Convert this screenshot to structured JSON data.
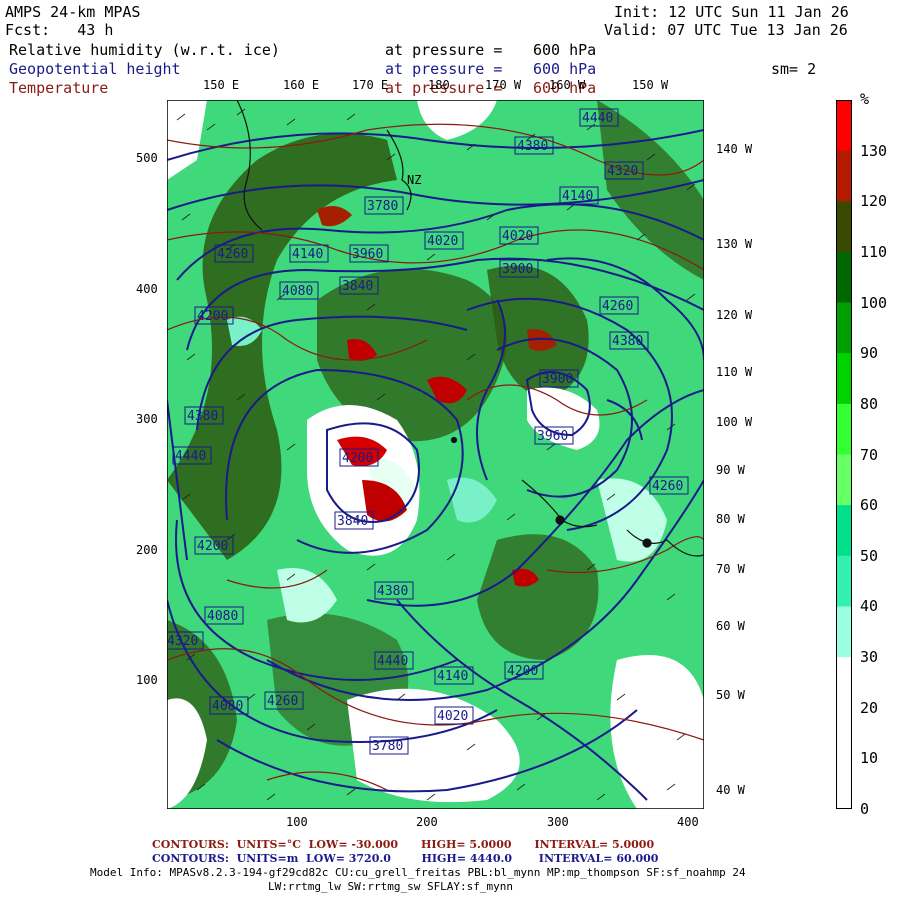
{
  "header": {
    "model": "AMPS 24-km MPAS",
    "fcst_label": "Fcst:",
    "fcst_value": "43 h",
    "init": "Init: 12 UTC Sun 11 Jan 26",
    "valid": "Valid: 07 UTC Tue 13 Jan 26",
    "fields": [
      {
        "name": "Relative humidity (w.r.t. ice)",
        "level_label": "at pressure =",
        "level": "600 hPa",
        "color": "#000000"
      },
      {
        "name": "Geopotential height",
        "level_label": "at pressure =",
        "level": "600 hPa",
        "color": "#1a1a8c"
      },
      {
        "name": "Temperature",
        "level_label": "at pressure =",
        "level": "600 hPa",
        "color": "#8b1a10"
      }
    ],
    "smoothing": "sm= 2"
  },
  "map": {
    "top_lon_labels": [
      "150 E",
      "160 E",
      "170 E",
      "180",
      "170 W",
      "160 W",
      "150 W"
    ],
    "right_lon_labels": [
      "140 W",
      "130 W",
      "120 W",
      "110 W",
      "100 W",
      "90 W",
      "80 W",
      "70 W",
      "60 W",
      "50 W",
      "40 W"
    ],
    "x_ticks": [
      "100",
      "200",
      "300",
      "400"
    ],
    "y_ticks": [
      "500",
      "400",
      "300",
      "200",
      "100"
    ],
    "height_labels": [
      "4380",
      "4440",
      "4260",
      "4200",
      "4140",
      "4080",
      "4020",
      "3960",
      "3900",
      "3840",
      "3780",
      "4260",
      "4380",
      "4440",
      "4200",
      "4080",
      "3960",
      "3900",
      "4020",
      "4140",
      "4320",
      "4380",
      "4260",
      "4200",
      "3840",
      "3780",
      "4080",
      "4020",
      "4140",
      "4200",
      "4260",
      "4320",
      "4380",
      "4440"
    ],
    "station_label": "NZ"
  },
  "colorbar": {
    "unit": "%",
    "labels": [
      "130",
      "120",
      "110",
      "100",
      "90",
      "80",
      "70",
      "60",
      "50",
      "40",
      "30",
      "20",
      "10",
      "0"
    ],
    "colors": [
      "#ff0000",
      "#b31a00",
      "#3a4a00",
      "#006600",
      "#00a000",
      "#00d200",
      "#33ff33",
      "#66ff66",
      "#00e08a",
      "#33f0b0",
      "#99ffe0",
      "#ffffff",
      "#ffffff",
      "#ffffff"
    ]
  },
  "footer": {
    "line1": {
      "label": "CONTOURS:",
      "units": "UNITS=°C",
      "low": "LOW= -30.000",
      "high": "HIGH= 5.0000",
      "interval": "INTERVAL= 5.0000",
      "color": "#8b1a10"
    },
    "line2": {
      "label": "CONTOURS:",
      "units": "UNITS=m",
      "low": "LOW= 3720.0",
      "high": "HIGH= 4440.0",
      "interval": "INTERVAL= 60.000",
      "color": "#1a1a8c"
    },
    "model_info": "Model Info: MPASv8.2.3-194-gf29cd82c CU:cu_grell_freitas PBL:bl_mynn MP:mp_thompson SF:sf_noahmp 24",
    "model_info2": "LW:rrtmg_lw SW:rrtmg_sw SFLAY:sf_mynn"
  }
}
